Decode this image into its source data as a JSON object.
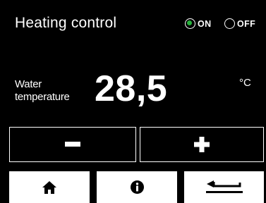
{
  "header": {
    "title": "Heating control",
    "power": {
      "on_label": "ON",
      "off_label": "OFF",
      "selected": "ON",
      "selected_color": "#27b23c"
    }
  },
  "readout": {
    "label_line1": "Water",
    "label_line2": "temperature",
    "value": "28,5",
    "unit": "°C"
  },
  "controls": {
    "decrease_icon": "minus-icon",
    "increase_icon": "plus-icon"
  },
  "nav": {
    "items": [
      {
        "icon": "home-icon"
      },
      {
        "icon": "info-icon"
      },
      {
        "icon": "return-arrow-icon"
      }
    ]
  },
  "colors": {
    "background": "#000000",
    "foreground": "#ffffff",
    "accent_on": "#27b23c"
  }
}
